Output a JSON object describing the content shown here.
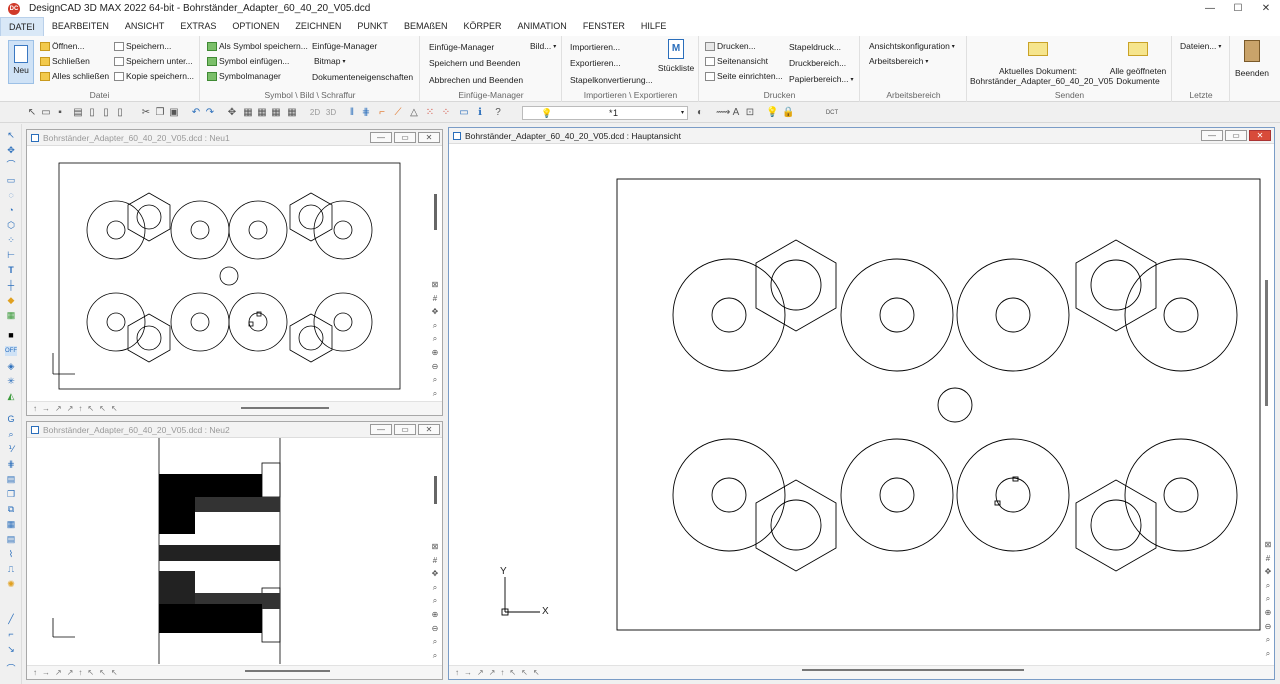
{
  "titlebar": {
    "app_icon": "DC",
    "title": "DesignCAD 3D MAX 2022 64-bit - Bohrständer_Adapter_60_40_20_V05.dcd",
    "controls": [
      "—",
      "☐",
      "✕"
    ]
  },
  "menu": [
    "DATEI",
    "BEARBEITEN",
    "ANSICHT",
    "EXTRAS",
    "OPTIONEN",
    "ZEICHNEN",
    "PUNKT",
    "BEMAßEN",
    "KÖRPER",
    "ANIMATION",
    "FENSTER",
    "HILFE"
  ],
  "ribbon": {
    "datei": {
      "caption": "Datei",
      "neu": "Neu",
      "items": [
        "Öffnen...",
        "Schließen",
        "Alles schließen",
        "Speichern...",
        "Speichern unter...",
        "Kopie speichern..."
      ]
    },
    "symbol": {
      "caption": "Symbol \\ Bild \\ Schraffur",
      "items": [
        "Als Symbol speichern...",
        "Symbol einfügen...",
        "Symbolmanager",
        "Einfüge-Manager",
        "Bitmap",
        "Dokumenteneigenschaften"
      ]
    },
    "einfuege": {
      "caption": "Einfüge-Manager",
      "items": [
        "Einfüge-Manager",
        "Bild...",
        "Speichern und Beenden",
        "Abbrechen und Beenden"
      ]
    },
    "import": {
      "caption": "Importieren \\ Exportieren",
      "items": [
        "Importieren...",
        "Exportieren...",
        "Stapelkonvertierung..."
      ],
      "stueckliste": "Stückliste"
    },
    "drucken": {
      "caption": "Drucken",
      "items": [
        "Drucken...",
        "Seitenansicht",
        "Seite einrichten...",
        "Stapeldruck...",
        "Druckbereich...",
        "Papierbereich..."
      ]
    },
    "arbeitsbereich": {
      "caption": "Arbeitsbereich",
      "items": [
        "Ansichtskonfiguration",
        "Arbeitsbereich"
      ]
    },
    "senden": {
      "caption": "Senden",
      "current_label": "Aktuelles Dokument:",
      "current_file": "Bohrständer_Adapter_60_40_20_V05",
      "all_open_1": "Alle geöffneten",
      "all_open_2": "Dokumente"
    },
    "letzte": {
      "caption": "Letzte",
      "dateien": "Dateien..."
    },
    "beenden": "Beenden"
  },
  "toolbar": {
    "view_2d": "2D",
    "view_3d": "3D",
    "line_value": "1",
    "layer_glyph": "*",
    "dct": "DCT"
  },
  "viewports": {
    "neu1_title": "Bohrständer_Adapter_60_40_20_V05.dcd : Neu1",
    "neu2_title": "Bohrständer_Adapter_60_40_20_V05.dcd : Neu2",
    "haupt_title": "Bohrständer_Adapter_60_40_20_V05.dcd : Hauptansicht",
    "axis_x": "X",
    "axis_y": "Y",
    "status_arrows": "↑→↗↗↑↖↖↖"
  },
  "colors": {
    "accent": "#2a6ebb",
    "ribbon_active": "#d9e8f7",
    "close_red": "#d84b3a"
  }
}
